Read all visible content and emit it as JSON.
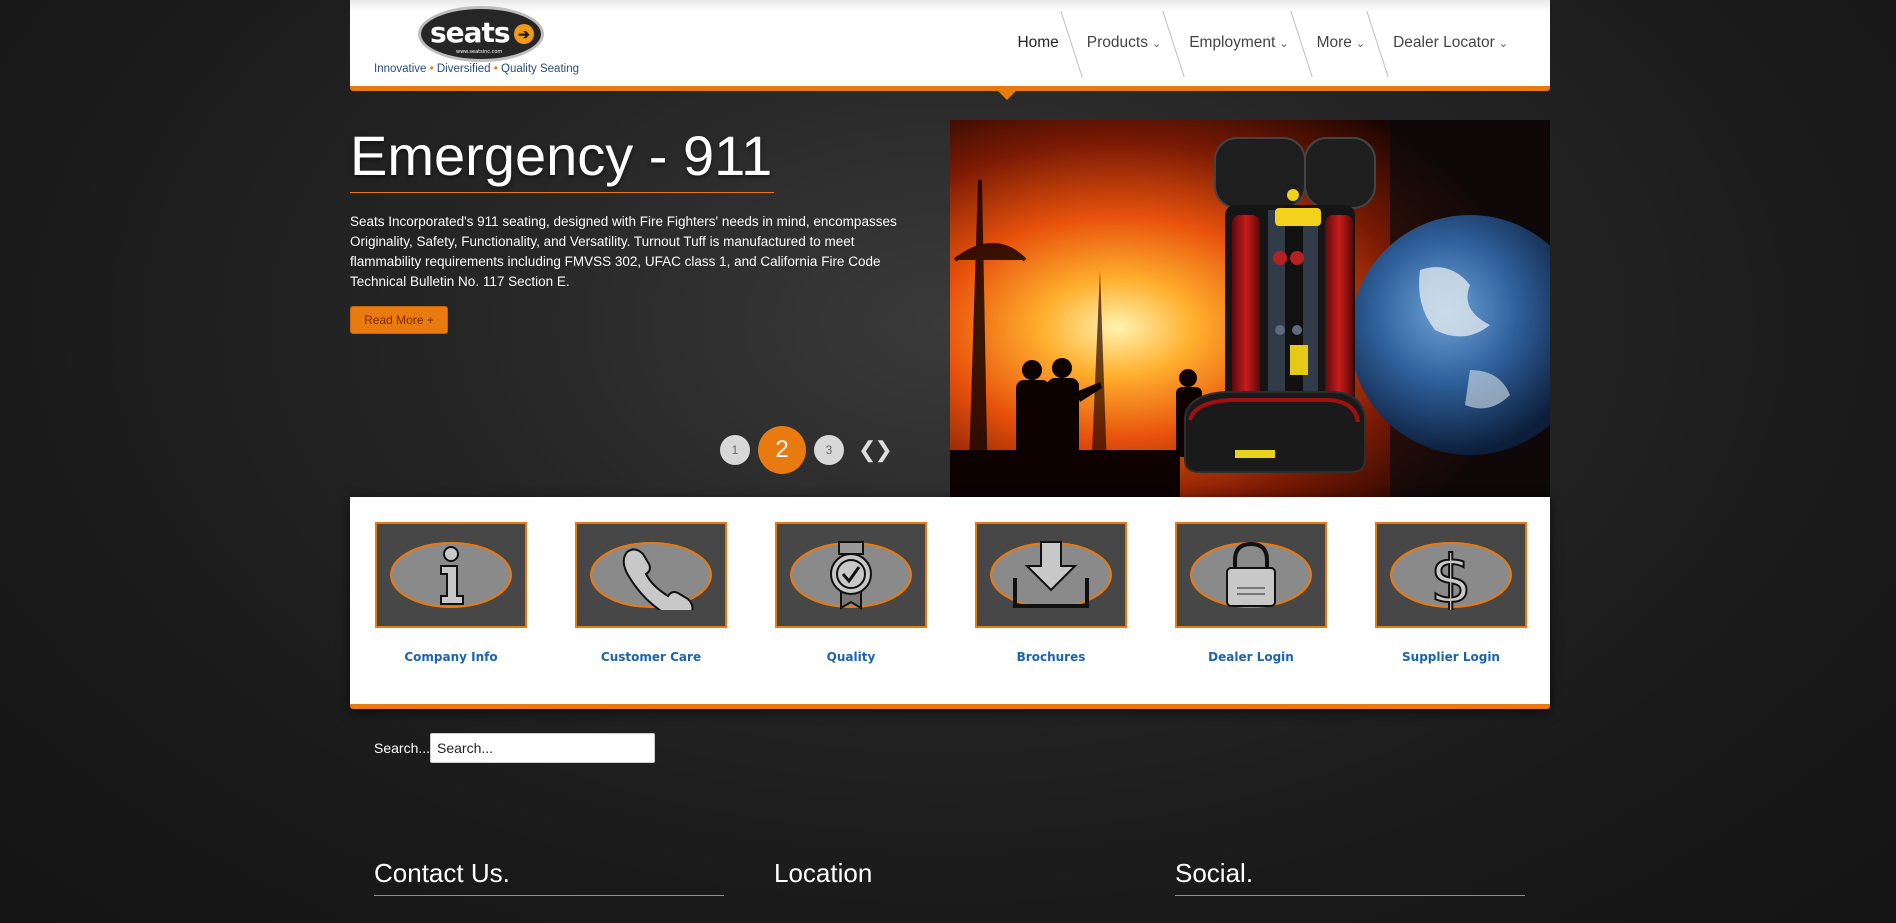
{
  "header": {
    "logo_text": "seats",
    "logo_url": "www.seatsinc.com",
    "tagline": [
      "Innovative",
      "Diversified",
      "Quality Seating"
    ],
    "tagline_sep": "•",
    "nav": [
      {
        "label": "Home",
        "dropdown": false
      },
      {
        "label": "Products",
        "dropdown": true
      },
      {
        "label": "Employment",
        "dropdown": true
      },
      {
        "label": "More",
        "dropdown": true
      },
      {
        "label": "Dealer Locator",
        "dropdown": true
      }
    ]
  },
  "hero": {
    "title": "Emergency - 911",
    "description": "Seats Incorporated's 911 seating, designed with Fire Fighters' needs in mind, encompasses Originality, Safety, Functionality, and Versatility. Turnout Tuff is manufactured to meet flammability requirements including FMVSS 302, UFAC class 1, and California Fire Code Technical Bulletin No. 117 Section E.",
    "read_more": "Read More +",
    "pages": [
      "1",
      "2",
      "3"
    ],
    "active_page": "2",
    "arrows": "❮❯",
    "image": "firefighter-seat-fire-earth"
  },
  "quick_links": [
    {
      "label": "Company Info",
      "icon": "info-icon"
    },
    {
      "label": "Customer Care",
      "icon": "phone-icon"
    },
    {
      "label": "Quality",
      "icon": "quality-badge-icon"
    },
    {
      "label": "Brochures",
      "icon": "download-icon"
    },
    {
      "label": "Dealer Login",
      "icon": "lock-icon"
    },
    {
      "label": "Supplier Login",
      "icon": "dollar-icon"
    }
  ],
  "search": {
    "label": "Search...",
    "value": "Search..."
  },
  "footer": {
    "contact": "Contact Us.",
    "location": "Location",
    "social": "Social."
  },
  "colors": {
    "accent": "#e97a10",
    "link": "#1a63b0",
    "tagline": "#2a4d7f"
  }
}
